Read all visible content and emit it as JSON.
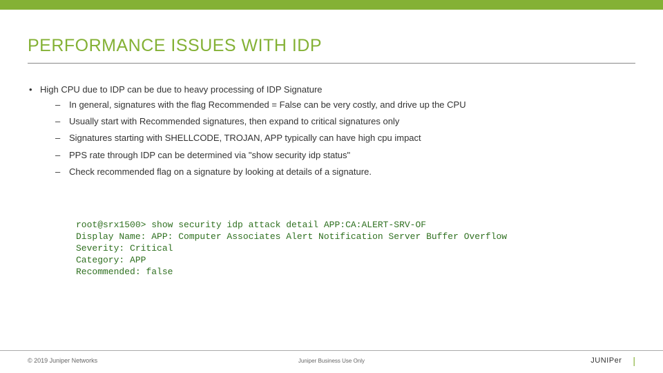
{
  "title": "PERFORMANCE ISSUES WITH IDP",
  "bullet": {
    "text": "High CPU due to IDP can be due to heavy processing of IDP Signature",
    "subs": [
      "In general, signatures with the flag Recommended = False can be very costly, and drive up the CPU",
      "Usually start with Recommended signatures, then expand to critical signatures only",
      "Signatures starting with SHELLCODE, TROJAN, APP typically can have high cpu impact",
      "PPS rate through IDP can be determined via \"show security idp status\"",
      "Check recommended flag on a signature by looking at details of a signature."
    ]
  },
  "cli": "root@srx1500> show security idp attack detail APP:CA:ALERT-SRV-OF\nDisplay Name: APP: Computer Associates Alert Notification Server Buffer Overflow\nSeverity: Critical\nCategory: APP\nRecommended: false",
  "footer": {
    "copyright": "© 2019 Juniper Networks",
    "center": "Juniper Business Use Only",
    "brand": "JUNIPer"
  }
}
